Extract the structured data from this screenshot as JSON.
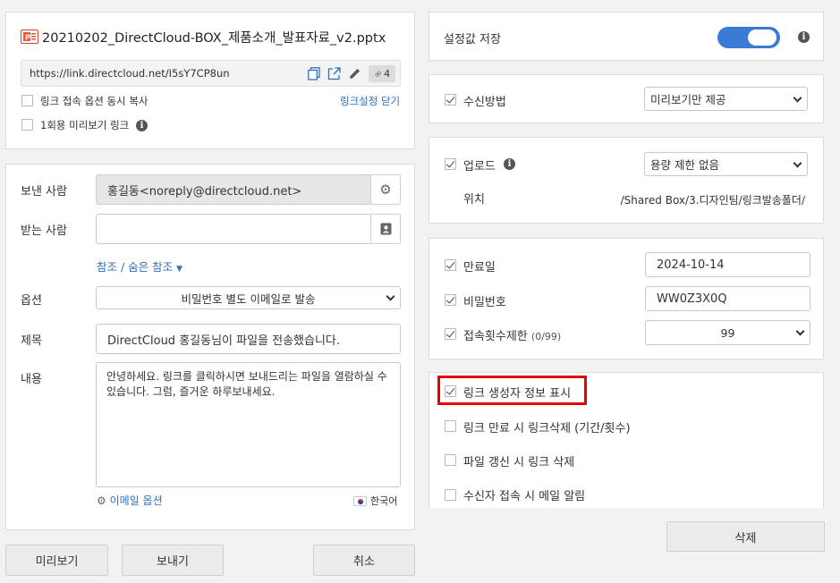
{
  "file": {
    "name": "20210202_DirectCloud-BOX_제품소개_발표자료_v2.pptx",
    "link_url": "https://link.directcloud.net/I5sY7CP8un",
    "link_count": "4",
    "copy_with_options_label": "링크 접속 옵션 동시 복사",
    "close_link_settings": "링크설정 닫기",
    "one_time_preview_label": "1회용 미리보기 링크"
  },
  "mail": {
    "sender_label": "보낸 사람",
    "sender_value": "홍길동<noreply@directcloud.net>",
    "recipient_label": "받는 사람",
    "recipient_value": "",
    "cc_bcc_label": "참조 / 숨은 참조",
    "options_label": "옵션",
    "options_value": "비밀번호 별도 이메일로 발송",
    "subject_label": "제목",
    "subject_value": "DirectCloud 홍길동님이 파일을 전송했습니다.",
    "body_label": "내용",
    "body_value": "안녕하세요. 링크를 클릭하시면 보내드리는 파일을 열람하실 수 있습니다. 그럼, 즐거운 하루보내세요.",
    "email_options_label": "이메일 옵션",
    "language_label": "한국어"
  },
  "buttons": {
    "preview": "미리보기",
    "send": "보내기",
    "cancel": "취소",
    "delete": "삭제"
  },
  "settings": {
    "save_settings_label": "설정값 저장",
    "save_settings_on": true,
    "receive_method_label": "수신방법",
    "receive_method_value": "미리보기만 제공",
    "upload_label": "업로드",
    "upload_value": "용량 제한 없음",
    "location_label": "위치",
    "location_value": "/Shared Box/3.디자인팀/링크발송폴더/",
    "expiry_label": "만료일",
    "expiry_value": "2024-10-14",
    "password_label": "비밀번호",
    "password_value": "WW0Z3X0Q",
    "access_limit_label": "접속횟수제한",
    "access_limit_count": "(0/99)",
    "access_limit_value": "99",
    "show_creator_label": "링크 생성자 정보 표시",
    "delete_on_expiry_label": "링크 만료 시 링크삭제 (기간/횟수)",
    "delete_on_update_label": "파일 갱신 시 링크 삭제",
    "notify_on_access_label": "수신자 접속 시 메일 알림"
  },
  "colors": {
    "accent_blue": "#2f6fbd",
    "toggle_blue": "#3a7bd5",
    "highlight_red": "#e60000"
  }
}
